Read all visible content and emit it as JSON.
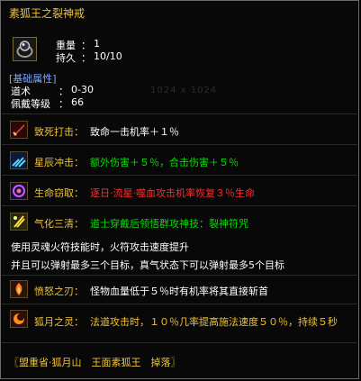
{
  "item": {
    "title": "素狐王之裂神戒",
    "weight_label": "重量",
    "weight_value": "1",
    "durability_label": "持久",
    "durability_value": "10/10",
    "colon": "："
  },
  "attributes": {
    "header": "[基础属性]",
    "rows": [
      {
        "label": "道术",
        "value": "0-30"
      },
      {
        "label": "佩戴等级",
        "value": "66"
      }
    ]
  },
  "watermark": "1024 x 1024",
  "skills": [
    {
      "name": "致死打击：",
      "desc": "致命一击机率＋１％",
      "color": "#ffffff",
      "icon": "sword-icon"
    },
    {
      "name": "星辰冲击：",
      "desc": "额外伤害＋５％，合击伤害＋５％",
      "color": "#00e000",
      "icon": "star-icon"
    },
    {
      "name": "生命窃取：",
      "desc": "逐日·流星·噬血攻击机率恢复３％生命",
      "color": "#ff3030",
      "icon": "life-icon"
    },
    {
      "name": "气化三清：",
      "desc": "道士穿戴后领悟群攻神技：裂神符咒",
      "color": "#00e000",
      "icon": "qi-icon"
    }
  ],
  "effect_lines": [
    "使用灵魂火符技能时，火符攻击速度提升",
    "并且可以弹射最多三个目标，真气状态下可以弹射最多5个目标"
  ],
  "skills2": [
    {
      "name": "愤怒之刃：",
      "desc": "怪物血量低于５％时有机率将其直接斩首",
      "color": "#ffffff",
      "icon": "fire-blade-icon"
    },
    {
      "name": "狐月之灵：",
      "desc": "法道攻击时，１０％几率提高施法速度５０％，持续５秒",
      "color": "#f1c232",
      "icon": "fox-moon-icon"
    }
  ],
  "source": "〖盟重省·狐月山　王面素狐王　掉落〗"
}
